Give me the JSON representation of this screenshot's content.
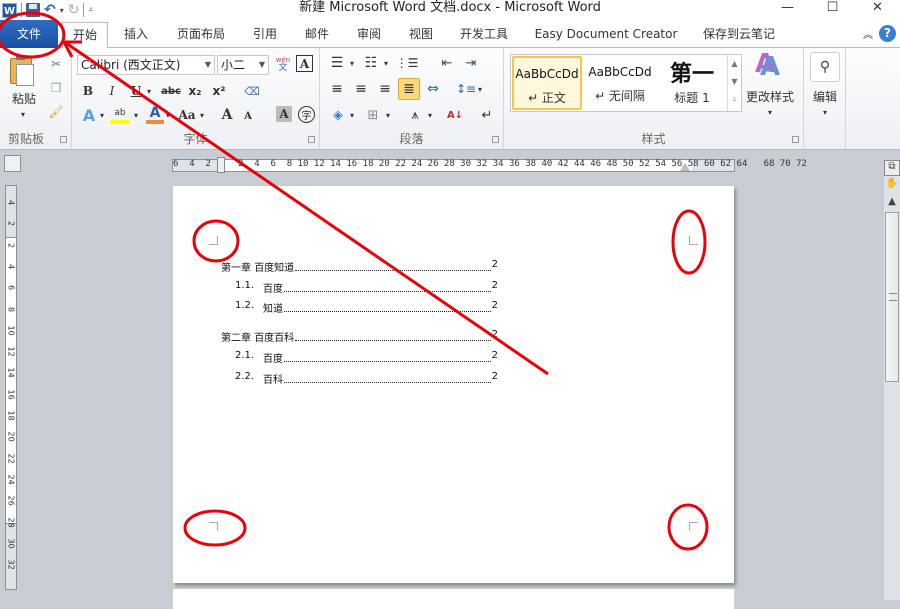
{
  "titlebar": {
    "title": "新建 Microsoft Word 文档.docx  -  Microsoft Word",
    "app_icon": "W",
    "minimize": "—",
    "maximize": "☐",
    "close": "✕"
  },
  "tabs": [
    {
      "label": "文件"
    },
    {
      "label": "开始"
    },
    {
      "label": "插入"
    },
    {
      "label": "页面布局"
    },
    {
      "label": "引用"
    },
    {
      "label": "邮件"
    },
    {
      "label": "审阅"
    },
    {
      "label": "视图"
    },
    {
      "label": "开发工具"
    },
    {
      "label": "Easy Document Creator"
    },
    {
      "label": "保存到云笔记"
    }
  ],
  "ribbon": {
    "clipboard": {
      "label": "剪贴板",
      "paste": "粘贴"
    },
    "font": {
      "label": "字体",
      "font_name": "Calibri (西文正文)",
      "font_size": "小二",
      "bold": "B",
      "italic": "I",
      "underline": "U",
      "strike": "abc",
      "subscript": "x₂",
      "superscript": "x²",
      "grow": "A",
      "shrink": "A",
      "case": "Aa",
      "char_shading": "A",
      "enclose": "字",
      "phonetic": "wén"
    },
    "paragraph": {
      "label": "段落"
    },
    "styles": {
      "label": "样式",
      "items": [
        {
          "sample": "AaBbCcDd",
          "name": "↵ 正文",
          "selected": true
        },
        {
          "sample": "AaBbCcDd",
          "name": "↵ 无间隔",
          "selected": false
        },
        {
          "sample": "第一",
          "name": "标题 1",
          "selected": false
        }
      ],
      "change_styles": "更改样式"
    },
    "editing": {
      "label": "编辑"
    }
  },
  "ruler": {
    "horizontal": "6  4  2     2  4  6  8 10 12 14 16 18 20 22 24 26 28 30 32 34 36 38 40 42 44 46 48 50 52 54 56 58 60 62 64   68 70 72",
    "vertical": [
      "4",
      "2",
      "2",
      "4",
      "6",
      "8",
      "10",
      "12",
      "14",
      "16",
      "18",
      "20",
      "22",
      "24",
      "26",
      "28",
      "30",
      "32"
    ]
  },
  "document": {
    "toc": [
      {
        "num": "第一章",
        "title": "百度知道",
        "page": "2",
        "level": 1
      },
      {
        "num": "1.1.",
        "title": "百度",
        "page": "2",
        "level": 2
      },
      {
        "num": "1.2.",
        "title": "知道",
        "page": "2",
        "level": 2
      },
      {
        "num": "第二章",
        "title": "百度百科",
        "page": "2",
        "level": 1
      },
      {
        "num": "2.1.",
        "title": "百度",
        "page": "2",
        "level": 2
      },
      {
        "num": "2.2.",
        "title": "百科",
        "page": "2",
        "level": 2
      }
    ]
  },
  "annotation": {
    "color": "#e8000b"
  }
}
